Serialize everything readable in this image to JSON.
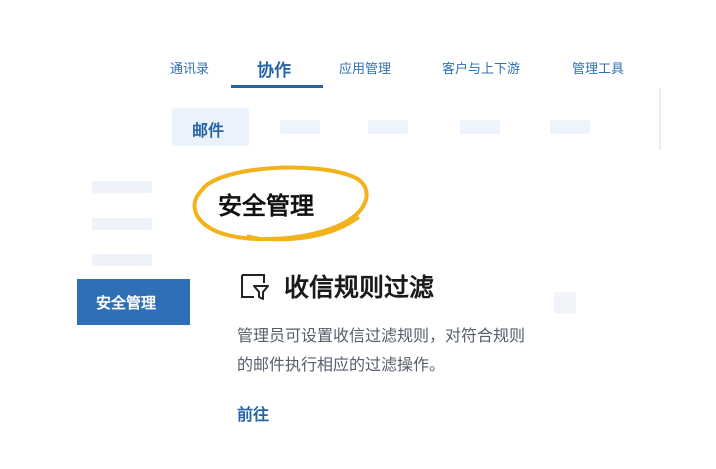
{
  "top_tabs": [
    "通讯录",
    "协作",
    "应用管理",
    "客户与上下游",
    "管理工具"
  ],
  "sub_tabs": {
    "active": "邮件"
  },
  "sidebar": {
    "active_item": "安全管理"
  },
  "highlight_title": "安全管理",
  "card": {
    "icon": "mail-filter-icon",
    "title": "收信规则过滤",
    "description": "管理员可设置收信过滤规则，对符合规则的邮件执行相应的过滤操作。",
    "action": "前往"
  },
  "colors": {
    "accent": "#2664a8",
    "sidebar_active_bg": "#2f6fb6",
    "highlight_ring": "#f2b21b"
  }
}
